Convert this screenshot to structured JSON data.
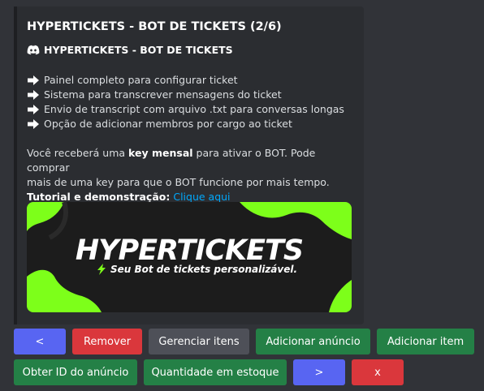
{
  "embed": {
    "title": "HYPERTICKETS - BOT DE TICKETS (2/6)",
    "author": "HYPERTICKETS - BOT DE TICKETS",
    "features": [
      "Painel completo para configurar ticket",
      "Sistema para transcrever mensagens do ticket",
      "Envio de transcript com arquivo .txt para conversas longas",
      "Opção de adicionar membros por cargo ao ticket"
    ],
    "description": {
      "line1_prefix": "Você receberá uma ",
      "line1_bold": "key mensal",
      "line1_suffix": " para ativar o BOT. Pode comprar",
      "line2": "mais de uma key para que o BOT funcione por mais tempo.",
      "tutorial_label": "Tutorial e demonstração:",
      "tutorial_link": "Clique aqui"
    },
    "banner": {
      "title": "HYPERTICKETS",
      "subtitle": "Seu Bot de tickets personalizável."
    }
  },
  "buttons": {
    "prev": "<",
    "remove": "Remover",
    "manage_items": "Gerenciar itens",
    "add_listing": "Adicionar anúncio",
    "add_item": "Adicionar item",
    "get_listing_id": "Obter ID do anúncio",
    "stock_quantity": "Quantidade em estoque",
    "next": ">",
    "close": "x"
  },
  "colors": {
    "background": "#313338",
    "embed": "#2b2d31",
    "blurple": "#5865f2",
    "danger": "#da373c",
    "secondary": "#4e5058",
    "success": "#248046",
    "link": "#00a8fc",
    "banner_accent": "#7dff1a"
  }
}
